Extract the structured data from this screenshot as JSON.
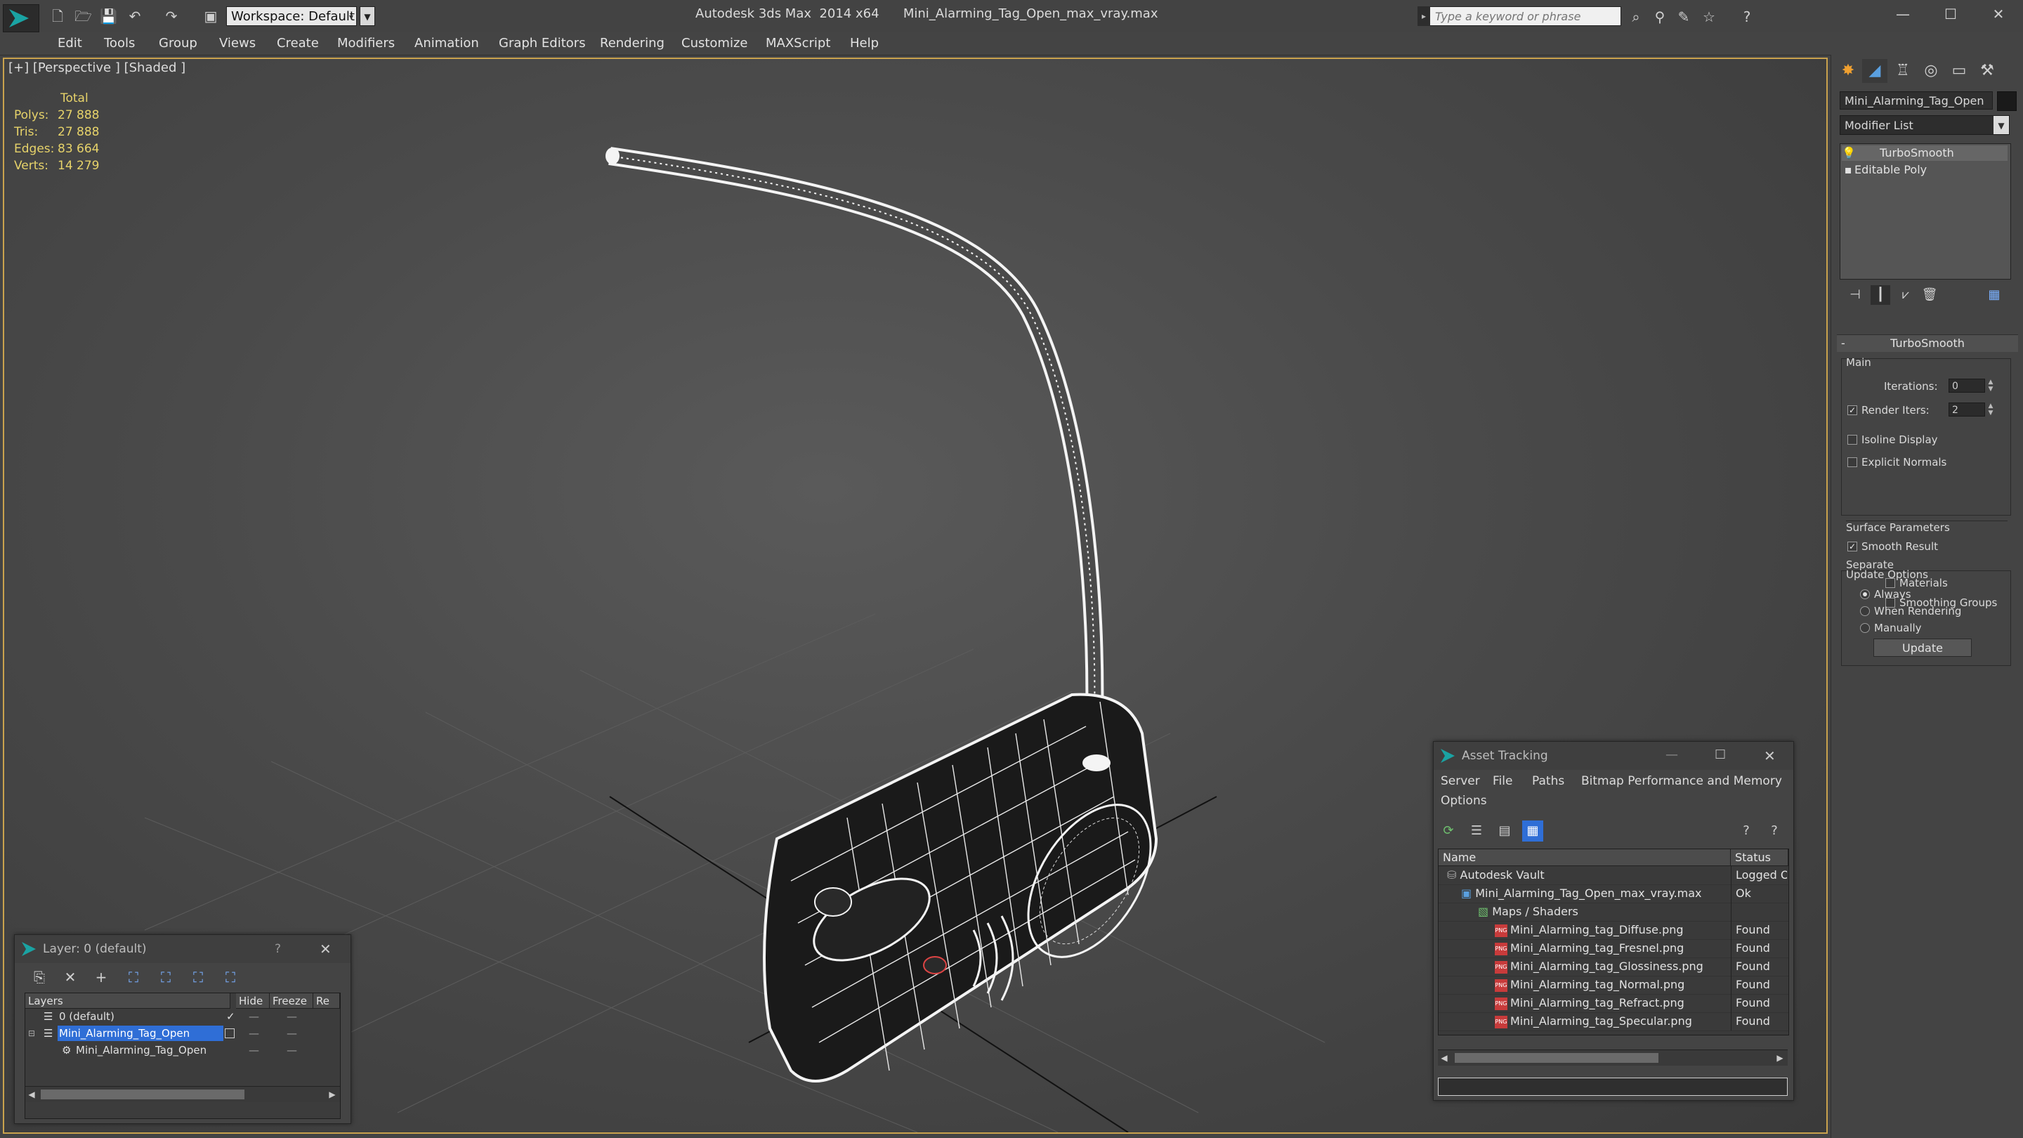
{
  "app": {
    "title": "Autodesk 3ds Max  2014 x64      Mini_Alarming_Tag_Open_max_vray.max",
    "workspace": "Workspace: Default",
    "search_placeholder": "Type a keyword or phrase"
  },
  "menu": [
    "Edit",
    "Tools",
    "Group",
    "Views",
    "Create",
    "Modifiers",
    "Animation",
    "Graph Editors",
    "Rendering",
    "Customize",
    "MAXScript",
    "Help"
  ],
  "viewport": {
    "label": "[+] [Perspective ] [Shaded ]",
    "stats": {
      "header": "Total",
      "rows": [
        {
          "label": "Polys:",
          "value": "27 888"
        },
        {
          "label": "Tris:",
          "value": "27 888"
        },
        {
          "label": "Edges:",
          "value": "83 664"
        },
        {
          "label": "Verts:",
          "value": "14 279"
        }
      ]
    }
  },
  "command_panel": {
    "object_name": "Mini_Alarming_Tag_Open",
    "modifier_list": "Modifier List",
    "stack": [
      "TurboSmooth",
      "Editable Poly"
    ],
    "rollout_title": "TurboSmooth",
    "main_group": "Main",
    "iterations_label": "Iterations:",
    "iterations_value": "0",
    "render_iters_label": "Render Iters:",
    "render_iters_value": "2",
    "render_iters_checked": true,
    "isoline_label": "Isoline Display",
    "isoline_checked": false,
    "explicit_normals_label": "Explicit Normals",
    "explicit_normals_checked": false,
    "surface_group": "Surface Parameters",
    "smooth_result_label": "Smooth Result",
    "smooth_result_checked": true,
    "separate_label": "Separate",
    "materials_label": "Materials",
    "materials_checked": false,
    "smoothing_groups_label": "Smoothing Groups",
    "smoothing_groups_checked": false,
    "update_group": "Update Options",
    "always_label": "Always",
    "when_rendering_label": "When Rendering",
    "manually_label": "Manually",
    "update_mode": "Always",
    "update_button": "Update"
  },
  "layer_window": {
    "title": "Layer: 0 (default)",
    "help": "?",
    "columns": [
      "Layers",
      "Hide",
      "Freeze",
      "Re"
    ],
    "rows": [
      {
        "name": "0 (default)",
        "indent": 1
      },
      {
        "name": "Mini_Alarming_Tag_Open",
        "indent": 1,
        "selected": true
      },
      {
        "name": "Mini_Alarming_Tag_Open",
        "indent": 2
      }
    ]
  },
  "asset_tracking": {
    "title": "Asset Tracking",
    "menu": [
      "Server",
      "File",
      "Paths",
      "Bitmap Performance and Memory",
      "Options"
    ],
    "columns": [
      "Name",
      "Status"
    ],
    "rows": [
      {
        "name": "Autodesk Vault",
        "status": "Logged Out",
        "indent": 0
      },
      {
        "name": "Mini_Alarming_Tag_Open_max_vray.max",
        "status": "Ok",
        "indent": 1
      },
      {
        "name": "Maps / Shaders",
        "status": "",
        "indent": 2
      },
      {
        "name": "Mini_Alarming_tag_Diffuse.png",
        "status": "Found",
        "indent": 3
      },
      {
        "name": "Mini_Alarming_tag_Fresnel.png",
        "status": "Found",
        "indent": 3
      },
      {
        "name": "Mini_Alarming_tag_Glossiness.png",
        "status": "Found",
        "indent": 3
      },
      {
        "name": "Mini_Alarming_tag_Normal.png",
        "status": "Found",
        "indent": 3
      },
      {
        "name": "Mini_Alarming_tag_Refract.png",
        "status": "Found",
        "indent": 3
      },
      {
        "name": "Mini_Alarming_tag_Specular.png",
        "status": "Found",
        "indent": 3
      }
    ]
  },
  "colors": {
    "background": "#444444",
    "viewport_border": "#c9a24d",
    "stats_text": "#e7d36a",
    "selection": "#2f6ed6",
    "wire": "#f4f4f4"
  }
}
